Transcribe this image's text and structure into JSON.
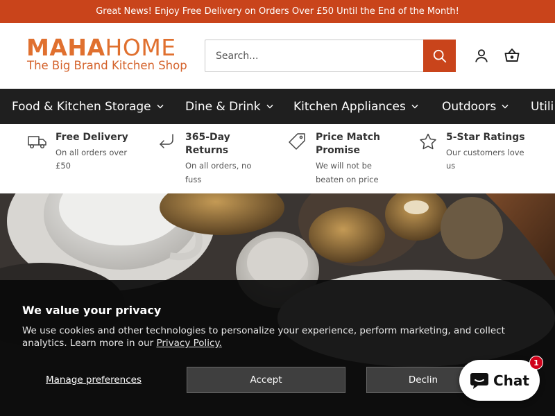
{
  "announcement": {
    "text": "Great News! Enjoy Free Delivery on Orders Over £50 Until the End of the Month!"
  },
  "brand": {
    "name_bold": "MAHA",
    "name_light": "HOME",
    "tagline": "The Big Brand Kitchen Shop",
    "accent_color": "#c9441b",
    "logo_color": "#e0702f"
  },
  "search": {
    "placeholder": "Search...",
    "icon": "search-icon"
  },
  "header_icons": {
    "account": "account-icon",
    "cart": "cart-icon"
  },
  "nav": {
    "items": [
      {
        "label": "Food & Kitchen Storage"
      },
      {
        "label": "Dine & Drink"
      },
      {
        "label": "Kitchen Appliances"
      },
      {
        "label": "Outdoors"
      },
      {
        "label": "Utili"
      }
    ]
  },
  "usps": [
    {
      "title": "Free Delivery",
      "sub1": "On all orders over",
      "sub2": "£50",
      "icon": "truck-icon"
    },
    {
      "title": "365-Day",
      "title2": "Returns",
      "sub1": "On all orders, no",
      "sub2": "fuss",
      "icon": "return-arrow-icon"
    },
    {
      "title": "Price Match",
      "title2": "Promise",
      "sub1": "We will not be",
      "sub2": "beaten on price",
      "icon": "price-tag-icon"
    },
    {
      "title": "5-Star Ratings",
      "sub1": "Our customers love",
      "sub2": "us",
      "icon": "star-icon"
    }
  ],
  "cookie": {
    "title": "We value your privacy",
    "text": "We use cookies and other technologies to personalize your experience, perform marketing, and collect analytics. Learn more in our ",
    "link": "Privacy Policy.",
    "manage": "Manage preferences",
    "accept": "Accept",
    "decline": "Declin"
  },
  "chat": {
    "label": "Chat",
    "badge": "1",
    "icon": "chat-bubble-icon"
  }
}
